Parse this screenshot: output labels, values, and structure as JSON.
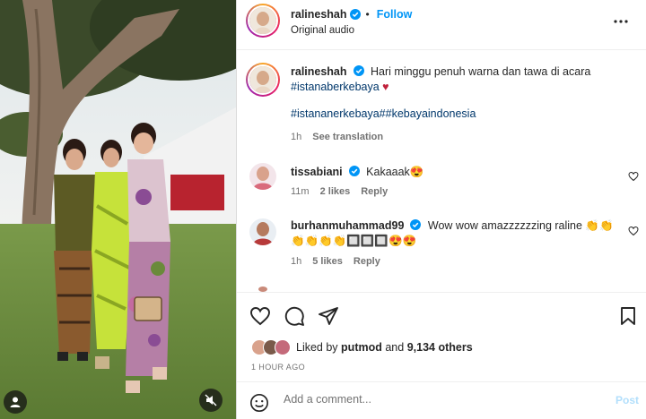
{
  "post": {
    "author": "ralineshah",
    "follow_label": "Follow",
    "separator": "•",
    "audio": "Original audio"
  },
  "caption": {
    "username": "ralineshah",
    "text": "Hari minggu penuh warna dan tawa di acara",
    "hashtag1": "#istanaberkebaya",
    "heart": "♥",
    "hashtags2": "#istananerkebaya##kebayaindonesia",
    "time": "1h",
    "translate": "See translation"
  },
  "comments": [
    {
      "username": "tissabiani",
      "text": "Kakaaak😍",
      "time": "11m",
      "likes": "2 likes",
      "reply": "Reply"
    },
    {
      "username": "burhanmuhammad99",
      "text": "Wow wow amazzzzzzing raline 👏👏",
      "text2": "👏👏👏👏🔲🔲🔲😍😍",
      "time": "1h",
      "likes": "5 likes",
      "reply": "Reply"
    }
  ],
  "likes": {
    "prefix": "Liked by",
    "user": "putmod",
    "middle": "and",
    "others": "9,134 others"
  },
  "time_ago": "1 HOUR AGO",
  "add_comment": {
    "placeholder": "Add a comment...",
    "post_label": "Post"
  },
  "colors": {
    "accent": "#0095f6",
    "verified": "#0095f6",
    "heart_red": "#ed4956",
    "post_disabled": "#b2dffc"
  },
  "icons": [
    "verified-icon",
    "more-icon",
    "heart-icon",
    "comment-icon",
    "share-icon",
    "bookmark-icon",
    "emoji-icon",
    "user-tag-icon",
    "mute-icon"
  ]
}
